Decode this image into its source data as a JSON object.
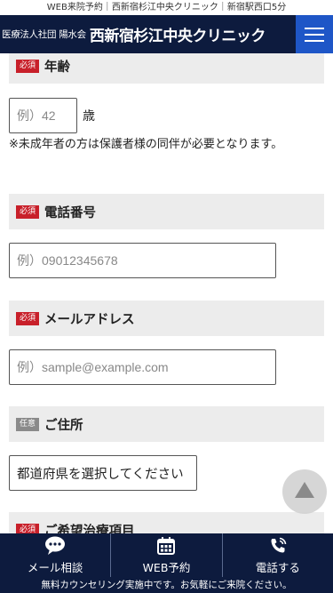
{
  "topbar": {
    "text": "WEB来院予約｜西新宿杉江中央クリニック｜新宿駅西口5分"
  },
  "header": {
    "org": "医療法人社団 陽水会",
    "clinic": "西新宿杉江中央クリニック"
  },
  "form": {
    "badge_required": "必須",
    "badge_optional": "任意",
    "age": {
      "title": "年齢",
      "placeholder": "例）42",
      "unit": "歳",
      "note": "※未成年者の方は保護者様の同伴が必要となります。"
    },
    "phone": {
      "title": "電話番号",
      "placeholder": "例）09012345678"
    },
    "email": {
      "title": "メールアドレス",
      "placeholder": "例）sample@example.com"
    },
    "address": {
      "title": "ご住所",
      "select_value": "都道府県を選択してください"
    },
    "treatment": {
      "title": "ご希望治療項目"
    }
  },
  "bottom_nav": {
    "items": [
      {
        "label": "メール相談",
        "icon": "chat-bubble-icon"
      },
      {
        "label": "WEB予約",
        "icon": "calendar-icon"
      },
      {
        "label": "電話する",
        "icon": "phone-icon"
      }
    ]
  },
  "footer": {
    "text": "無料カウンセリング実施中です。お気軽にご来院ください。"
  },
  "colors": {
    "navy": "#0d1b3e",
    "accent_blue": "#1e56c7",
    "required_red": "#c8202a",
    "section_bg": "#ececec"
  }
}
